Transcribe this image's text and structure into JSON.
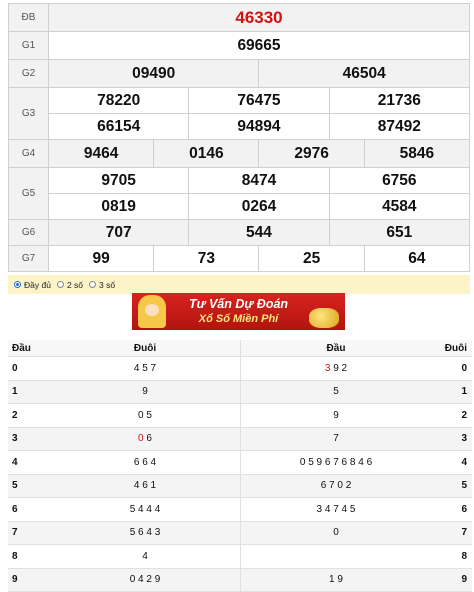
{
  "results": {
    "rows": [
      {
        "label": "ĐB",
        "values": [
          "46330"
        ]
      },
      {
        "label": "G1",
        "values": [
          "69665"
        ]
      },
      {
        "label": "G2",
        "values": [
          "09490",
          "46504"
        ]
      },
      {
        "label": "G3",
        "values": [
          "78220",
          "76475",
          "21736",
          "66154",
          "94894",
          "87492"
        ]
      },
      {
        "label": "G4",
        "values": [
          "9464",
          "0146",
          "2976",
          "5846"
        ]
      },
      {
        "label": "G5",
        "values": [
          "9705",
          "8474",
          "6756",
          "0819",
          "0264",
          "4584"
        ]
      },
      {
        "label": "G6",
        "values": [
          "707",
          "544",
          "651"
        ]
      },
      {
        "label": "G7",
        "values": [
          "99",
          "73",
          "25",
          "64"
        ]
      }
    ]
  },
  "options": {
    "full": "Đầy đủ",
    "two": "2 số",
    "three": "3 số",
    "selected": "full"
  },
  "banner": {
    "line1": "Tư Vấn Dự Đoán",
    "line2": "Xổ Số Miền Phí"
  },
  "lotto": {
    "headers": {
      "dau": "Đầu",
      "duoi": "Đuôi",
      "dau2": "Đầu",
      "duoi2": "Đuôi"
    },
    "rows": [
      {
        "dau": "0",
        "duoi": "4 5 7",
        "dau2_pre": "",
        "dau2_hl": "3",
        "dau2_post": " 9 2",
        "duoi2": "0"
      },
      {
        "dau": "1",
        "duoi": "9",
        "dau2_pre": "5",
        "dau2_hl": "",
        "dau2_post": "",
        "duoi2": "1"
      },
      {
        "dau": "2",
        "duoi": "0 5",
        "dau2_pre": "9",
        "dau2_hl": "",
        "dau2_post": "",
        "duoi2": "2"
      },
      {
        "dau": "3",
        "duoi_pre": "",
        "duoi_hl": "0",
        "duoi_post": " 6",
        "dau2_pre": "7",
        "dau2_hl": "",
        "dau2_post": "",
        "duoi2": "3"
      },
      {
        "dau": "4",
        "duoi": "6 6 4",
        "dau2_pre": "0 5 9 6 7 6 8 4 6",
        "dau2_hl": "",
        "dau2_post": "",
        "duoi2": "4"
      },
      {
        "dau": "5",
        "duoi": "4 6 1",
        "dau2_pre": "6 7 0 2",
        "dau2_hl": "",
        "dau2_post": "",
        "duoi2": "5"
      },
      {
        "dau": "6",
        "duoi": "5 4 4 4",
        "dau2_pre": "3 4 7 4 5",
        "dau2_hl": "",
        "dau2_post": "",
        "duoi2": "6"
      },
      {
        "dau": "7",
        "duoi": "5 6 4 3",
        "dau2_pre": "0",
        "dau2_hl": "",
        "dau2_post": "",
        "duoi2": "7"
      },
      {
        "dau": "8",
        "duoi": "4",
        "dau2_pre": "",
        "dau2_hl": "",
        "dau2_post": "",
        "duoi2": "8"
      },
      {
        "dau": "9",
        "duoi": "0 4 2 9",
        "dau2_pre": "1 9",
        "dau2_hl": "",
        "dau2_post": "",
        "duoi2": "9"
      }
    ]
  },
  "colors": {
    "special": "#d11212",
    "option_bar": "#fcf3c9",
    "banner": "#d8231f"
  }
}
